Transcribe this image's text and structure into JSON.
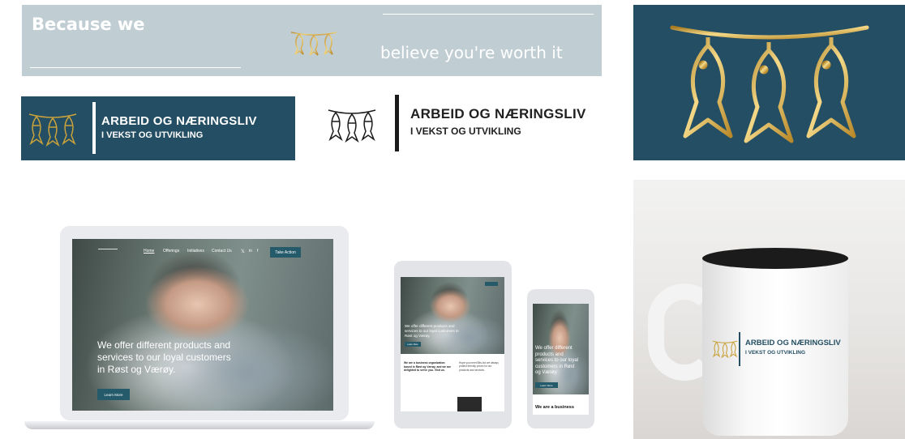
{
  "banner": {
    "left_text": "Because we",
    "right_text": "believe you're worth it",
    "bg_color": "#c0ced4",
    "fish_icon": "hanging-fish-icon"
  },
  "logo": {
    "title": "ARBEID OG NÆRINGSLIV",
    "subtitle": "I VEKST OG UTVIKLING",
    "primary_color": "#244e64",
    "gold_color": "#c9a23a",
    "icon": "hanging-fish-icon"
  },
  "website": {
    "nav": {
      "items": [
        "Home",
        "Offerings",
        "Initiatives",
        "Contact Us"
      ],
      "social": [
        "x-icon",
        "linkedin-icon",
        "facebook-icon"
      ],
      "cta": "Take Action"
    },
    "hero_text": "We offer different products and services to our loyal customers in Røst og Værøy.",
    "hero_button": "Learn More",
    "about_left": "We are a business organization based in Røst og Værøy, and we are delighted to serve you. Visit us.",
    "about_right": "Hope you meet Bits-bol we always protect friendly prices for our products and services.",
    "phone_footer": "We are a business"
  }
}
